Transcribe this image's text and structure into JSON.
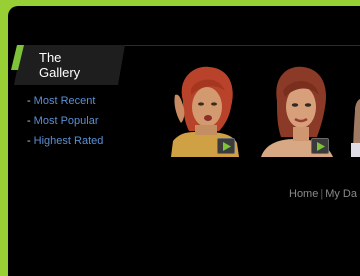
{
  "header": {
    "title_line1": "The",
    "title_line2": "Gallery"
  },
  "sidebar": {
    "links": [
      {
        "label": "Most Recent"
      },
      {
        "label": "Most Popular"
      },
      {
        "label": "Highest Rated"
      }
    ],
    "bullet": "-"
  },
  "footer_nav": {
    "home": "Home",
    "separator": "|",
    "my_da": "My Da"
  },
  "colors": {
    "page_border": "#97cf35",
    "background": "#000000",
    "accent_green": "#7ec23a",
    "link_blue": "#5a8fd4",
    "play_icon_green": "#7ec23a"
  },
  "icons": {
    "header_accent": "green-slash-icon",
    "play": "play-icon"
  }
}
